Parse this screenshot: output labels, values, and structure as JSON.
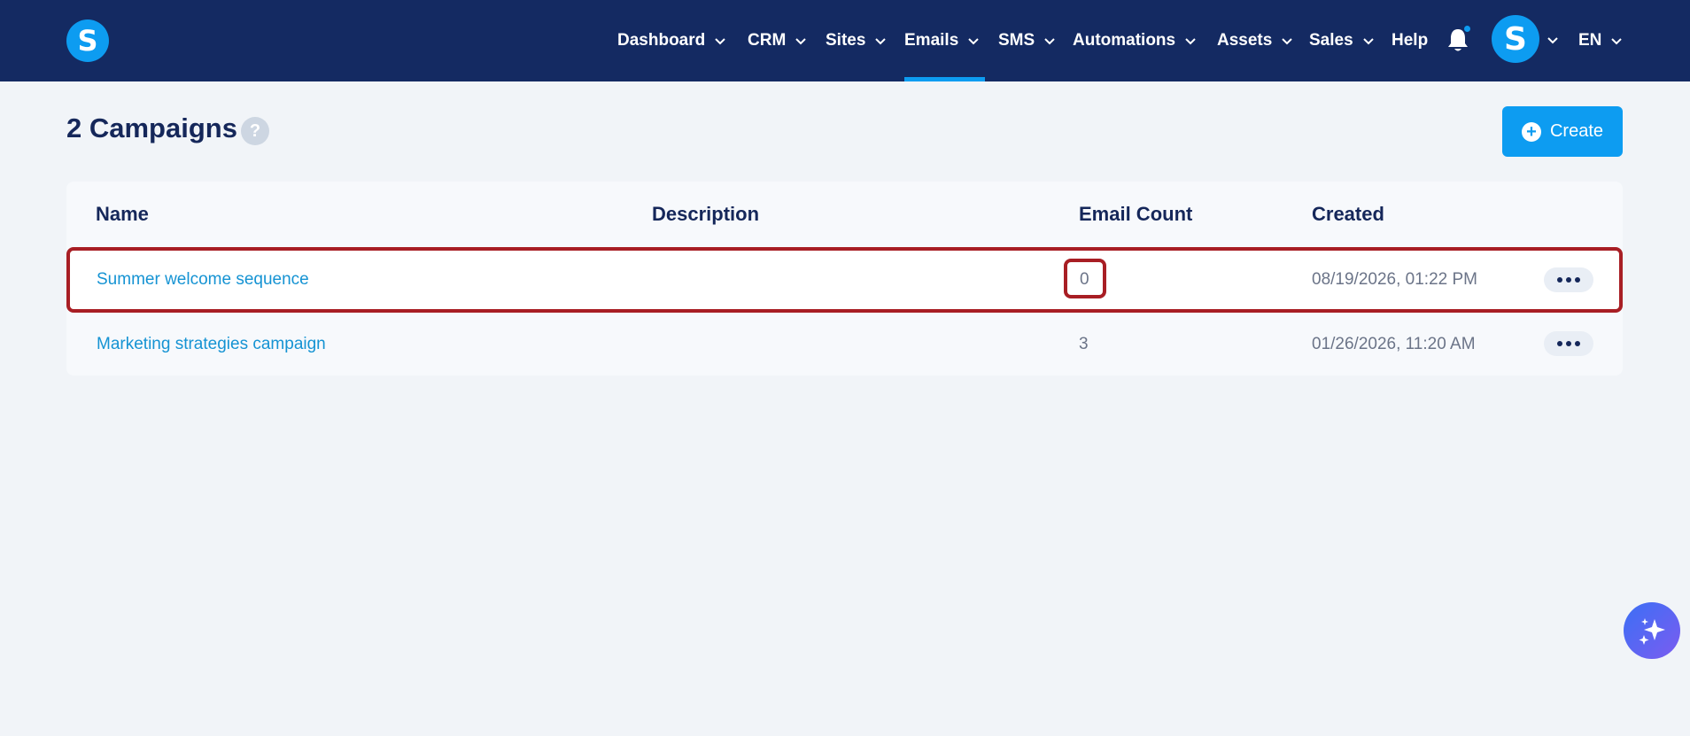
{
  "brand": {
    "logo_letter": "S"
  },
  "nav": {
    "items": [
      {
        "label": "Dashboard"
      },
      {
        "label": "CRM"
      },
      {
        "label": "Sites"
      },
      {
        "label": "Emails"
      },
      {
        "label": "SMS"
      },
      {
        "label": "Automations"
      },
      {
        "label": "Assets"
      },
      {
        "label": "Sales"
      },
      {
        "label": "Help"
      }
    ],
    "active": "Emails",
    "avatar_letter": "S",
    "language": "EN"
  },
  "page": {
    "title": "2 Campaigns",
    "help_glyph": "?",
    "create_label": "Create"
  },
  "table": {
    "columns": [
      "Name",
      "Description",
      "Email Count",
      "Created"
    ],
    "rows": [
      {
        "name": "Summer welcome sequence",
        "description": "",
        "email_count": "0",
        "created": "08/19/2026, 01:22 PM"
      },
      {
        "name": "Marketing strategies campaign",
        "description": "",
        "email_count": "3",
        "created": "01/26/2026, 11:20 AM"
      }
    ]
  },
  "colors": {
    "nav_bg": "#142a62",
    "accent": "#0d9cf1",
    "highlight": "#a81e24",
    "link": "#1593d3"
  },
  "icons": [
    "bell-icon",
    "chevron-down-icon",
    "plus-circle-icon",
    "help-icon",
    "more-dots-icon",
    "sparkle-icon"
  ]
}
